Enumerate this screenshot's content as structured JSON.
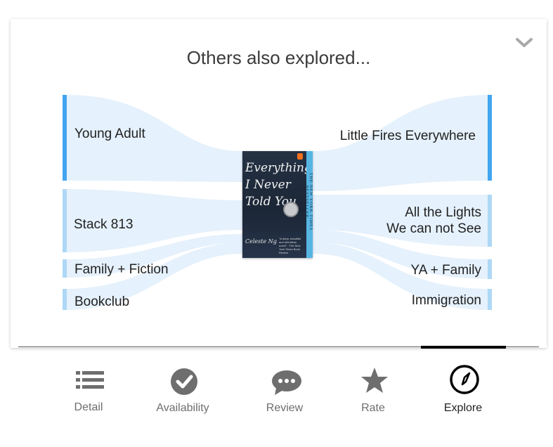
{
  "panel": {
    "title": "Others also explored..."
  },
  "left_nodes": [
    {
      "label": "Young Adult"
    },
    {
      "label": "Stack 813"
    },
    {
      "label": "Family + Fiction"
    },
    {
      "label": "Bookclub"
    }
  ],
  "right_nodes": [
    {
      "label": "Little Fires Everywhere"
    },
    {
      "label": "All the Lights\nWe can not See"
    },
    {
      "label": "YA + Family"
    },
    {
      "label": "Immigration"
    }
  ],
  "book": {
    "title": "Everything I Never Told You",
    "author": "Celeste Ng",
    "spine": "THE NEW YORK TIMES BESTSELLER",
    "blurb": "\"A deep, beautiful and relentless novel\" - The New York Times Book Review"
  },
  "tabs": [
    {
      "label": "Detail",
      "icon": "list-icon",
      "active": false
    },
    {
      "label": "Availability",
      "icon": "check-circle-icon",
      "active": false
    },
    {
      "label": "Review",
      "icon": "chat-bubble-icon",
      "active": false
    },
    {
      "label": "Rate",
      "icon": "star-icon",
      "active": false
    },
    {
      "label": "Explore",
      "icon": "compass-icon",
      "active": true
    }
  ],
  "colors": {
    "node_dark": "#42a5f0",
    "node_light": "#aed8f6",
    "flow": "#d6ebfb",
    "icon_gray": "#6e6e6e",
    "active_tab": "#000000"
  }
}
